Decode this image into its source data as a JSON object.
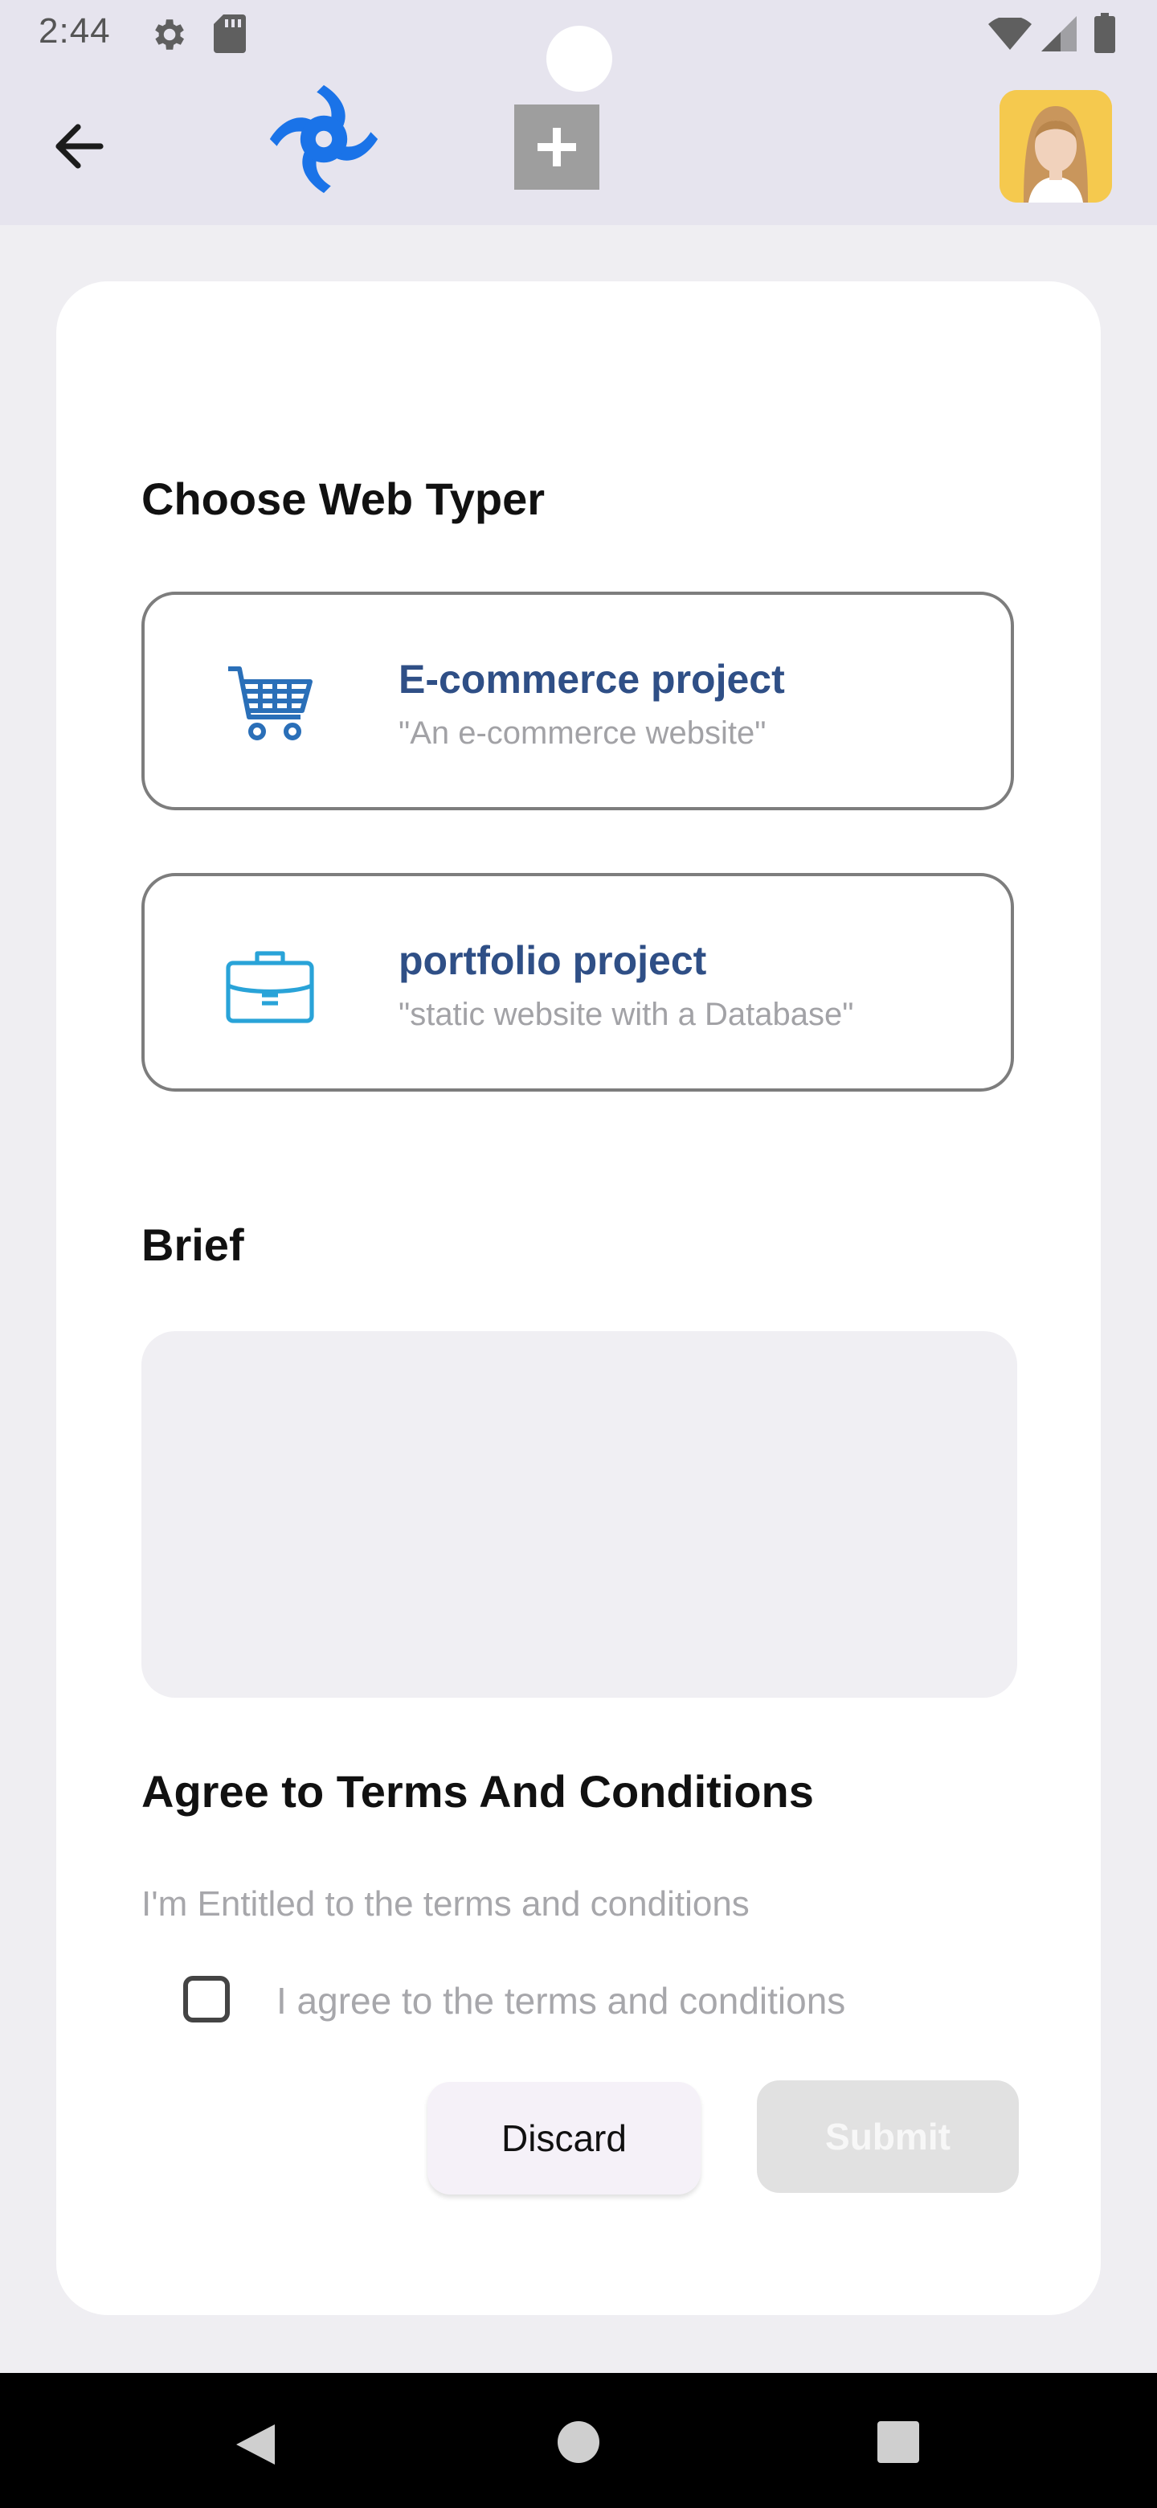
{
  "status_bar": {
    "time": "2:44",
    "icons": [
      "settings-icon",
      "sd-card-icon",
      "wifi-icon",
      "signal-icon",
      "battery-icon"
    ]
  },
  "app_bar": {
    "back_icon": "arrow-left-icon",
    "logo_icon": "app-logo-icon",
    "add_icon": "plus-icon",
    "avatar": "user-avatar"
  },
  "form": {
    "choose_title": "Choose Web Typer",
    "options": [
      {
        "title": "E-commerce project",
        "subtitle": "\"An e-commerce website\"",
        "icon": "shopping-cart-icon"
      },
      {
        "title": "portfolio project",
        "subtitle": "\"static website with a Database\"",
        "icon": "briefcase-icon"
      }
    ],
    "brief_title": "Brief",
    "brief_value": "",
    "terms_title": "Agree to Terms And Conditions",
    "terms_hint": "I'm Entitled to the terms and conditions",
    "checkbox_label": "I agree to the terms and conditions",
    "checkbox_checked": false,
    "discard_label": "Discard",
    "submit_label": "Submit"
  },
  "colors": {
    "header_bg": "#e6e4ee",
    "page_bg": "#efeef2",
    "option_title": "#2f4f86",
    "logo_blue": "#1a73e8",
    "cart_blue": "#2a6fb8",
    "briefcase_blue": "#29a3d8"
  }
}
